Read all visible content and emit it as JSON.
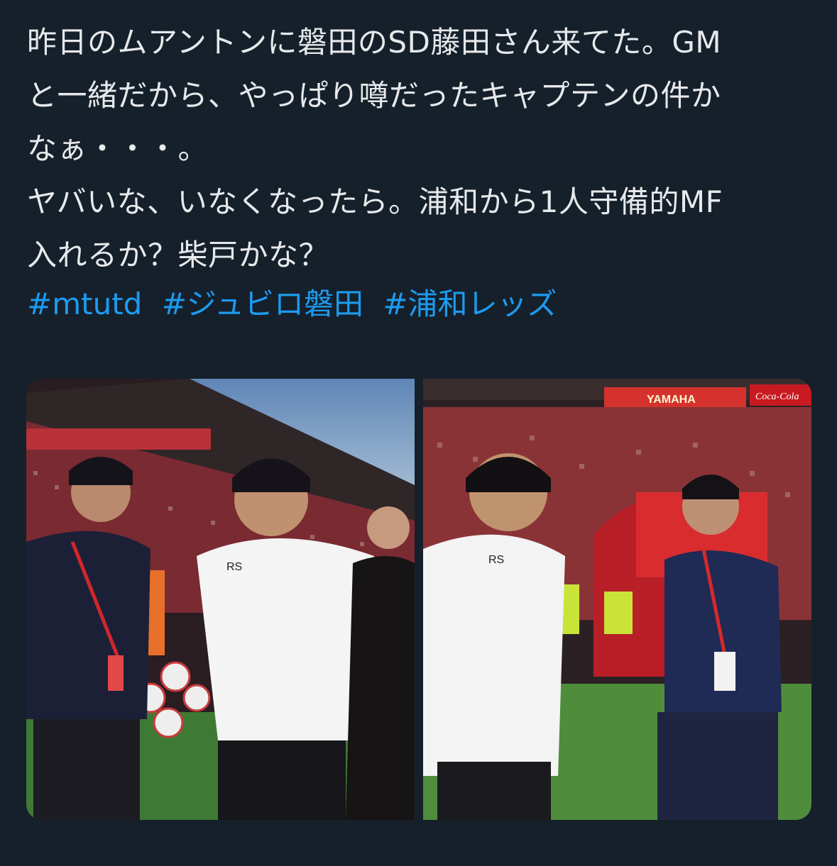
{
  "tweet": {
    "text": "昨日のムアントンに磐田のSD藤田さん来てた。GM\nと一緒だから、やっぱり噂だったキャプテンの件か\nなぁ・・・。\nヤバいな、いなくなったら。浦和から1人守備的MF\n入れるか？柴戸かな？",
    "hashtags": [
      "#mtutd",
      "#ジュビロ磐田",
      "#浦和レッズ"
    ]
  },
  "media": {
    "photos": [
      {
        "shirt_text": "RS"
      },
      {
        "shirt_text": "RS",
        "banner_text_1": "YAMAHA",
        "banner_text_2": "Coca-Cola"
      }
    ]
  },
  "colors": {
    "background": "#15202b",
    "link": "#1d9bf0",
    "text": "#e7e9ea"
  }
}
